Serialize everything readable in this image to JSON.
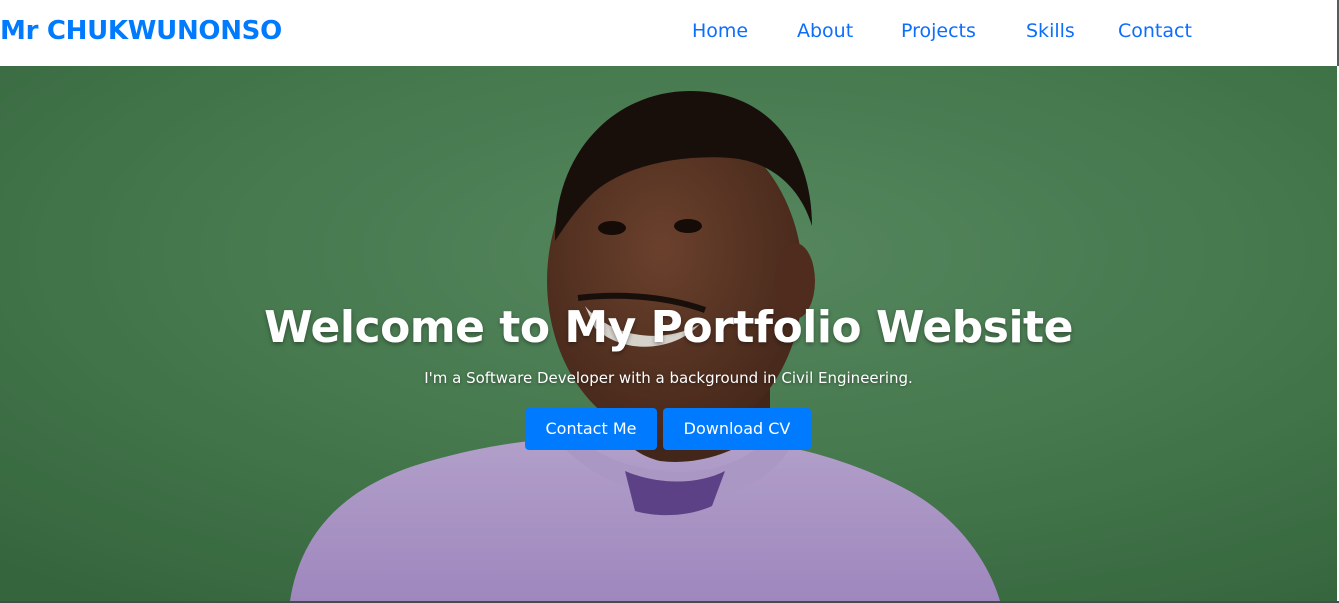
{
  "colors": {
    "accent": "#007bff",
    "nav_link": "#0d6efd"
  },
  "brand": "Mr CHUKWUNONSO",
  "nav": {
    "links": [
      "Home",
      "About",
      "Projects",
      "Skills",
      "Contact"
    ]
  },
  "hero": {
    "title": "Welcome to My Portfolio Website",
    "subtitle": "I'm a Software Developer with a background in Civil Engineering.",
    "primary_button": "Contact Me",
    "secondary_button": "Download CV",
    "background_image": "portrait-photo"
  }
}
